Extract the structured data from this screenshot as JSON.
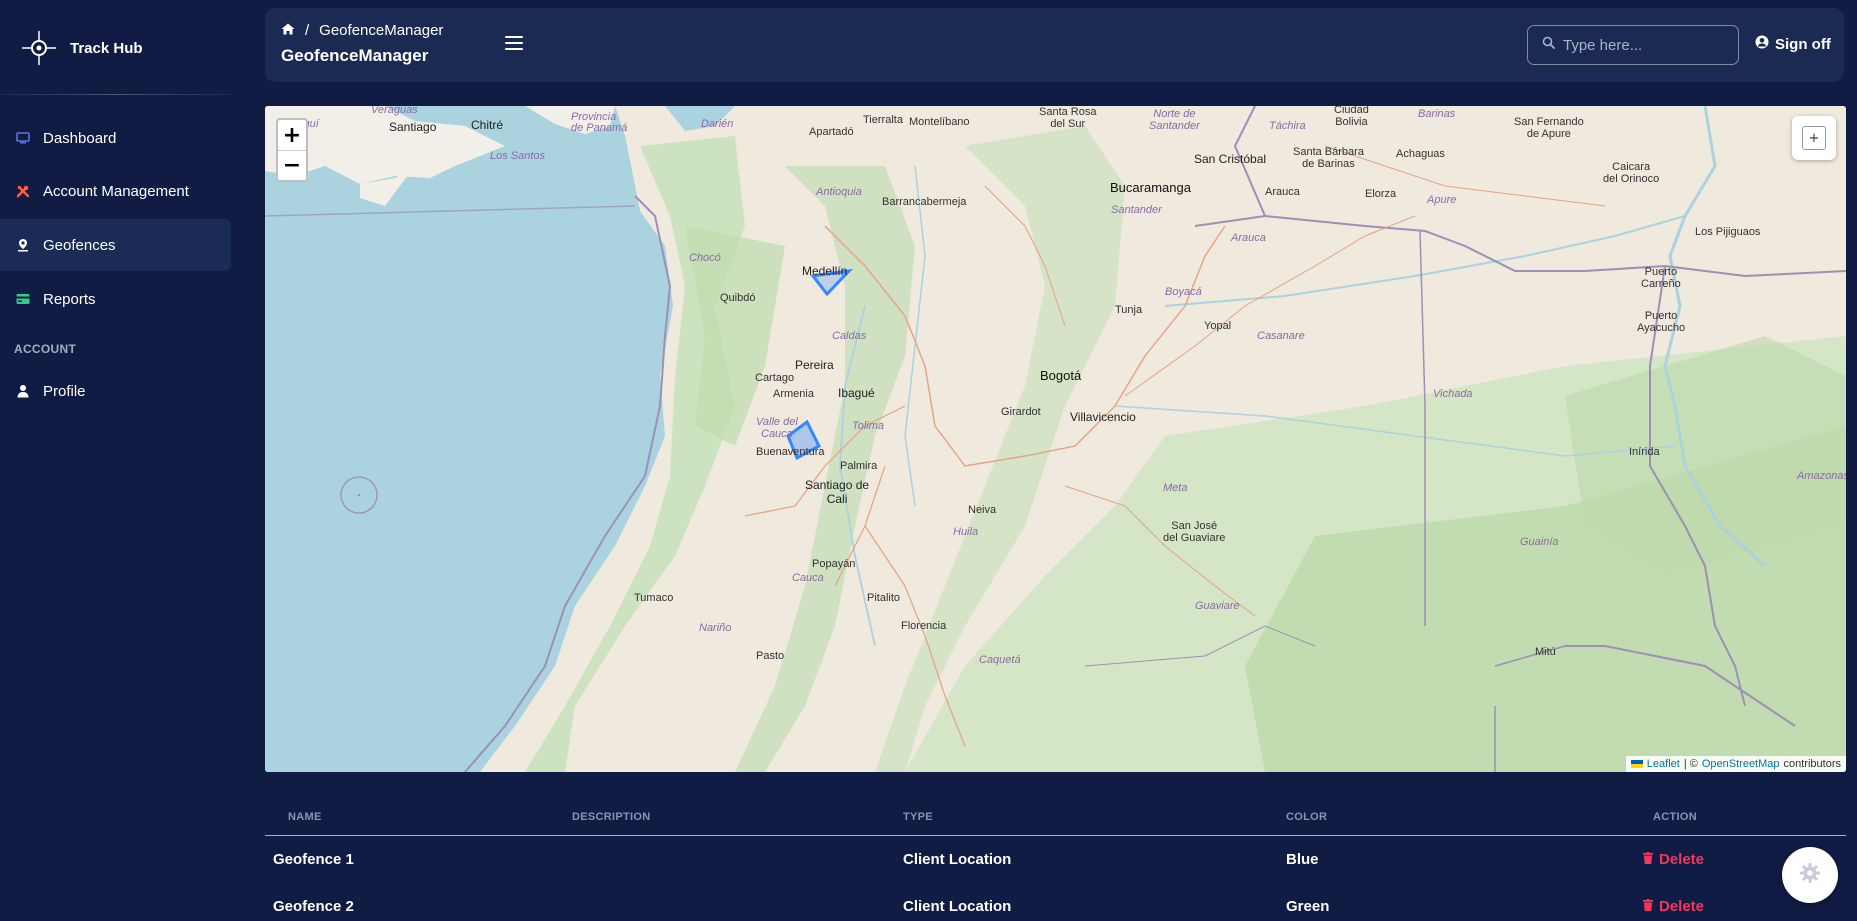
{
  "sidebar": {
    "brand": "Track Hub",
    "items": [
      {
        "label": "Dashboard"
      },
      {
        "label": "Account Management"
      },
      {
        "label": "Geofences"
      },
      {
        "label": "Reports"
      }
    ],
    "section_label": "ACCOUNT",
    "account_items": [
      {
        "label": "Profile"
      }
    ]
  },
  "header": {
    "breadcrumb_page": "GeofenceManager",
    "title": "GeofenceManager",
    "search_placeholder": "Type here...",
    "signoff_label": "Sign off"
  },
  "map": {
    "zoom_in": "+",
    "zoom_out": "−",
    "draw_control": "+",
    "attribution": {
      "leaflet": "Leaflet",
      "separator": "| ©",
      "osm": "OpenStreetMap",
      "suffix": "contributors"
    },
    "labels": {
      "santiago": "Santiago",
      "chitre": "Chitré",
      "los_santos": "Los Santos",
      "veraguas": "Veraguas",
      "riquí": "iriquí",
      "provincia_panama": "Provincia\nde Panamá",
      "darien": "Darién",
      "tierralta": "Tierralta",
      "montelibano": "Montelíbano",
      "apartado": "Apartadó",
      "santa_rosa": "Santa Rosa\ndel Sur",
      "norte_santander": "Norte de\nSantander",
      "tachira": "Táchira",
      "san_cristobal": "San Cristóbal",
      "santa_barbara": "Santa Bárbara\nde Barinas",
      "achaguas": "Achaguas",
      "san_fernando": "San Fernando\nde Apure",
      "caicara": "Caicara\ndel Orinoco",
      "barinas": "Barinas",
      "bolivia": "Ciudad\nBolivia",
      "antioquia": "Antioquia",
      "barrancabermeja": "Barrancabermeja",
      "bucaramanga": "Bucaramanga",
      "santander": "Santander",
      "arauca_city": "Arauca",
      "elorza": "Elorza",
      "apure": "Apure",
      "arauca_region": "Arauca",
      "los_pijiguaos": "Los Pijiguaos",
      "choco": "Chocó",
      "medellin": "Medellín",
      "quibdo": "Quibdó",
      "boyaca": "Boyacá",
      "tunja": "Tunja",
      "yopal": "Yopal",
      "casanare": "Casanare",
      "puerto_carreno": "Puerto\nCarreño",
      "puerto_ayacucho": "Puerto\nAyacucho",
      "caldas": "Caldas",
      "pereira": "Pereira",
      "cartago": "Cartago",
      "armenia": "Armenia",
      "ibague": "Ibagué",
      "bogota": "Bogotá",
      "girardot": "Girardot",
      "villavicencio": "Villavicencio",
      "vichada": "Vichada",
      "valle_cauca": "Valle del\nCauca",
      "tolima": "Tolima",
      "buenaventura": "Buenaventura",
      "palmira": "Palmira",
      "inirida": "Inírida",
      "santiago_cali": "Santiago de\nCali",
      "meta": "Meta",
      "amazonas": "Amazonas",
      "neiva": "Neiva",
      "san_jose": "San José\ndel Guaviare",
      "huila": "Huila",
      "guainia": "Guainía",
      "popayan": "Popayán",
      "cauca": "Cauca",
      "tumaco": "Tumaco",
      "pitalito": "Pitalito",
      "guaviare": "Guaviare",
      "narino": "Nariño",
      "florencia": "Florencia",
      "pasto": "Pasto",
      "caqueta": "Caquetá",
      "mitu": "Mitú"
    }
  },
  "table": {
    "columns": [
      "NAME",
      "DESCRIPTION",
      "TYPE",
      "COLOR",
      "ACTION"
    ],
    "rows": [
      {
        "name": "Geofence 1",
        "description": "",
        "type": "Client Location",
        "color": "Blue",
        "action": "Delete"
      },
      {
        "name": "Geofence 2",
        "description": "",
        "type": "Client Location",
        "color": "Green",
        "action": "Delete"
      }
    ]
  },
  "colors": {
    "background": "#111c44",
    "card": "#1b2a52",
    "active_nav": "#1a2b55",
    "delete": "#f5365c",
    "geofence": "#3388ff"
  }
}
